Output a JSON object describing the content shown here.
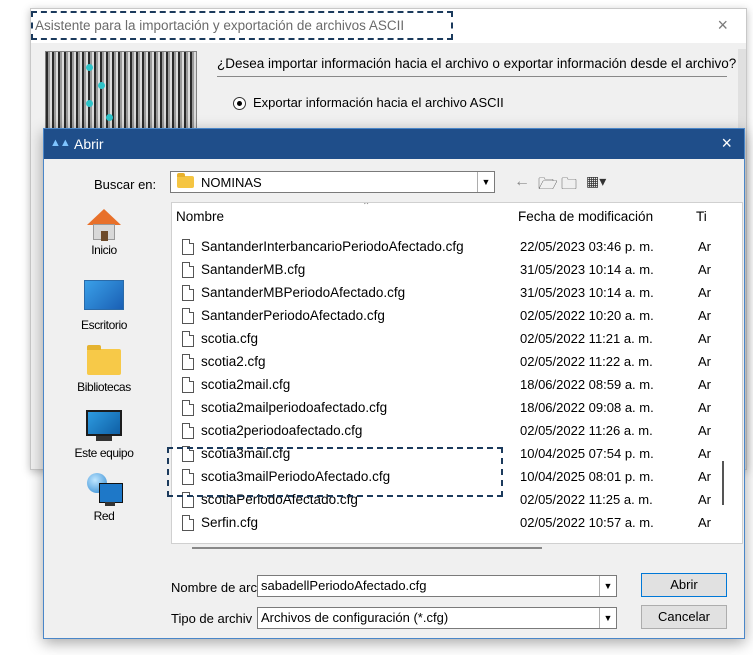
{
  "wizard": {
    "title": "Asistente para la importación y exportación de archivos ASCII",
    "question": "¿Desea importar información hacia el archivo o exportar información desde el archivo?",
    "option_export": "Exportar información hacia el archivo ASCII",
    "close_icon": "×"
  },
  "dialog": {
    "title": "Abrir",
    "close_icon": "×",
    "look_in_label": "Buscar en:",
    "look_in_value": "NOMINAS",
    "places": [
      {
        "label": "Inicio",
        "icon": "home-icon"
      },
      {
        "label": "Escritorio",
        "icon": "desktop-icon"
      },
      {
        "label": "Bibliotecas",
        "icon": "libraries-icon"
      },
      {
        "label": "Este equipo",
        "icon": "this-pc-icon"
      },
      {
        "label": "Red",
        "icon": "network-icon"
      }
    ],
    "columns": {
      "name": "Nombre",
      "date": "Fecha de modificación",
      "type": "Ti"
    },
    "files": [
      {
        "name": "SantanderInterbancarioPeriodoAfectado.cfg",
        "date": "22/05/2023 03:46 p. m.",
        "type": "Ar"
      },
      {
        "name": "SantanderMB.cfg",
        "date": "31/05/2023 10:14 a. m.",
        "type": "Ar"
      },
      {
        "name": "SantanderMBPeriodoAfectado.cfg",
        "date": "31/05/2023 10:14 a. m.",
        "type": "Ar"
      },
      {
        "name": "SantanderPeriodoAfectado.cfg",
        "date": "02/05/2022 10:20 a. m.",
        "type": "Ar"
      },
      {
        "name": "scotia.cfg",
        "date": "02/05/2022 11:21 a. m.",
        "type": "Ar"
      },
      {
        "name": "scotia2.cfg",
        "date": "02/05/2022 11:22 a. m.",
        "type": "Ar"
      },
      {
        "name": "scotia2mail.cfg",
        "date": "18/06/2022 08:59 a. m.",
        "type": "Ar"
      },
      {
        "name": "scotia2mailperiodoafectado.cfg",
        "date": "18/06/2022 09:08 a. m.",
        "type": "Ar"
      },
      {
        "name": "scotia2periodoafectado.cfg",
        "date": "02/05/2022 11:26 a. m.",
        "type": "Ar"
      },
      {
        "name": "scotia3mail.cfg",
        "date": "10/04/2025 07:54 p. m.",
        "type": "Ar"
      },
      {
        "name": "scotia3mailPeriodoAfectado.cfg",
        "date": "10/04/2025 08:01 p. m.",
        "type": "Ar"
      },
      {
        "name": "scotiaPeriodoAfectado.cfg",
        "date": "02/05/2022 11:25 a. m.",
        "type": "Ar"
      },
      {
        "name": "Serfin.cfg",
        "date": "02/05/2022 10:57 a. m.",
        "type": "Ar"
      }
    ],
    "filename_label": "Nombre de arc",
    "filename_value": "sabadellPeriodoAfectado.cfg",
    "filetype_label": "Tipo de archiv",
    "filetype_value": "Archivos de configuración (*.cfg)",
    "open_button": "Abrir",
    "cancel_button": "Cancelar"
  },
  "colors": {
    "dialog_titlebar": "#1f4e8a",
    "highlight": "#1b3a5c"
  }
}
